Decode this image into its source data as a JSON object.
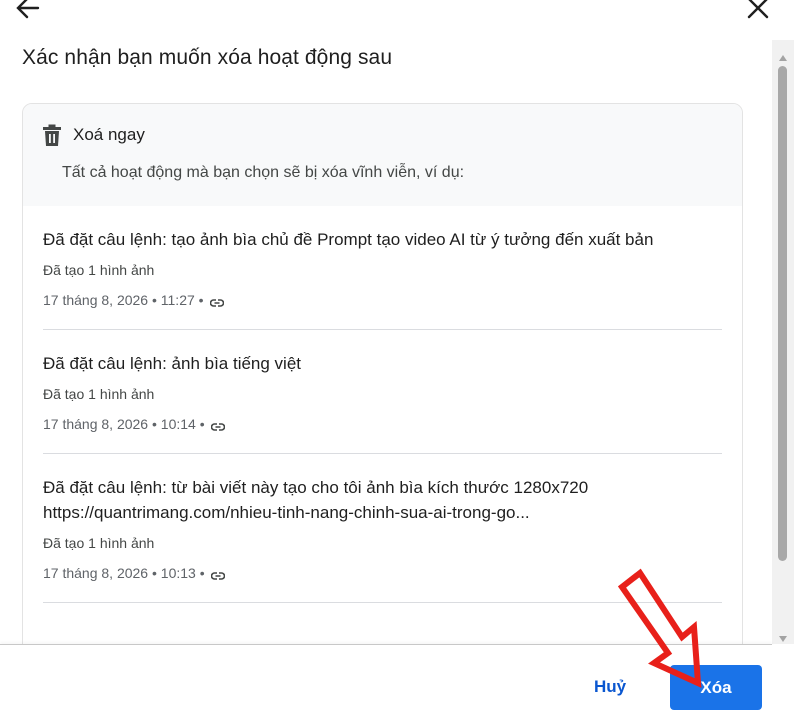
{
  "dialog": {
    "title": "Xác nhận bạn muốn xóa hoạt động sau"
  },
  "card": {
    "icon": "trash-icon",
    "title": "Xoá ngay",
    "description": "Tất cả hoạt động mà bạn chọn sẽ bị xóa vĩnh viễn, ví dụ:"
  },
  "activities": [
    {
      "title": "Đã đặt câu lệnh: tạo ảnh bìa chủ đề Prompt tạo video AI từ ý tưởng đến xuất bản",
      "subtitle": "Đã tạo 1 hình ảnh",
      "timestamp": "17 tháng 8, 2026 • 11:27 •"
    },
    {
      "title": "Đã đặt câu lệnh: ảnh bìa tiếng việt",
      "subtitle": "Đã tạo 1 hình ảnh",
      "timestamp": "17 tháng 8, 2026 • 10:14 •"
    },
    {
      "title": "Đã đặt câu lệnh: từ bài viết này tạo cho tôi ảnh bìa kích thước 1280x720 https://quantrimang.com/nhieu-tinh-nang-chinh-sua-ai-trong-go...",
      "subtitle": "Đã tạo 1 hình ảnh",
      "timestamp": "17 tháng 8, 2026 • 10:13 •"
    }
  ],
  "footer": {
    "cancel_label": "Huỷ",
    "delete_label": "Xóa"
  },
  "colors": {
    "primary": "#1a73e8",
    "link": "#0b57d0",
    "annotation": "#e8201a"
  }
}
